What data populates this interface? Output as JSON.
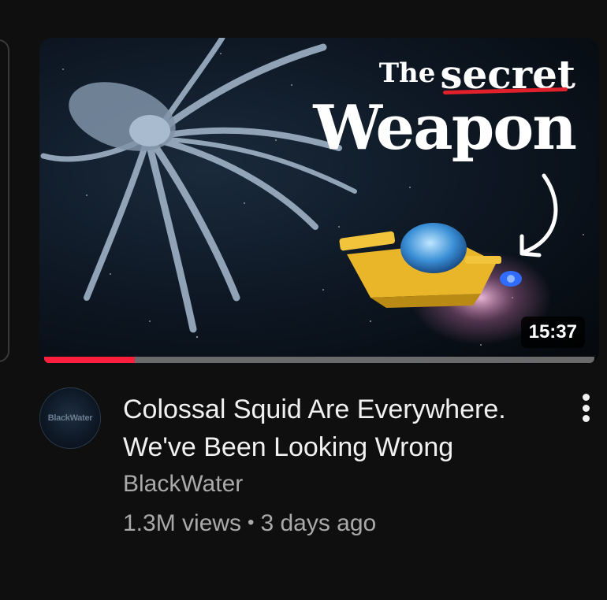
{
  "video": {
    "thumbnail": {
      "title_word_1": "The",
      "title_word_2": "secret",
      "title_word_3": "Weapon",
      "underline_color": "#e0202a"
    },
    "duration": "15:37",
    "watch_progress_percent": 16.5,
    "progress_color": "#ff1f3d",
    "title": "Colossal Squid Are Everywhere. We've Been Looking Wrong",
    "channel": {
      "name": "BlackWater",
      "avatar_text": "BlackWater"
    },
    "views": "1.3M views",
    "separator": "•",
    "age": "3 days ago",
    "menu_icon": "more-vert-icon"
  }
}
